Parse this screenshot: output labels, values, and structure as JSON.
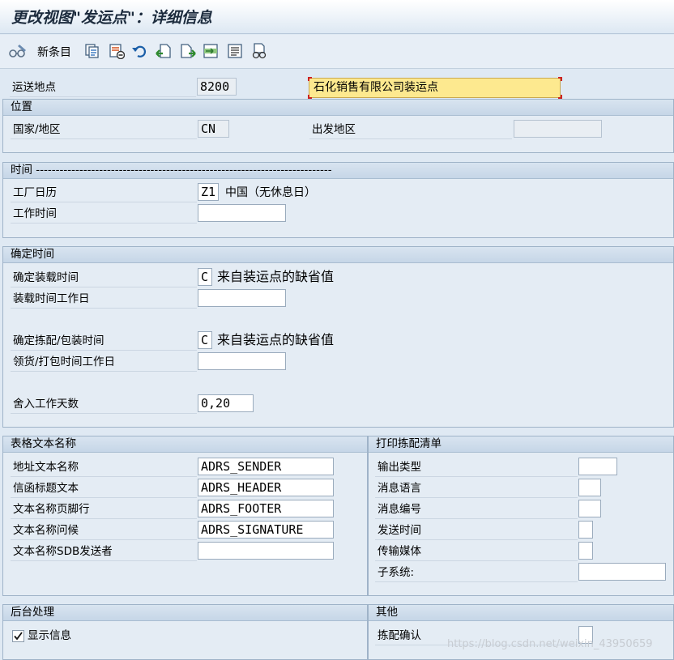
{
  "title": "更改视图\"发运点\"：详细信息",
  "toolbar": {
    "new_entries": "新条目",
    "icons": [
      "glasses-edit-icon",
      "copy-icon",
      "delete-icon",
      "undo-icon",
      "previous-entry-icon",
      "next-entry-icon",
      "select-block-icon",
      "select-all-icon",
      "print-icon"
    ]
  },
  "header": {
    "shipping_point_label": "运送地点",
    "shipping_point_value": "8200",
    "shipping_point_desc": "石化销售有限公司装运点"
  },
  "location": {
    "title": "位置",
    "country_label": "国家/地区",
    "country_value": "CN",
    "departure_zone_label": "出发地区",
    "departure_zone_value": ""
  },
  "time": {
    "title": "时间 ---------------------------------------------------------------------------",
    "factory_calendar_label": "工厂日历",
    "factory_calendar_value": "Z1",
    "factory_calendar_desc": "中国（无休息日）",
    "working_times_label": "工作时间",
    "working_times_value": ""
  },
  "determine_times": {
    "title": "确定时间",
    "loading_time_label": "确定装载时间",
    "loading_time_value": "C",
    "loading_time_desc": "来自装运点的缺省值",
    "loading_workday_label": "装载时间工作日",
    "loading_workday_value": "",
    "pick_pack_label": "确定拣配/包装时间",
    "pick_pack_value": "C",
    "pick_pack_desc": "来自装运点的缺省值",
    "pick_pack_workday_label": "领货/打包时间工作日",
    "pick_pack_workday_value": "",
    "rounding_label": "舍入工作天数",
    "rounding_value": "0,20"
  },
  "form_text": {
    "title": "表格文本名称",
    "rows": [
      {
        "label": "地址文本名称",
        "value": "ADRS_SENDER"
      },
      {
        "label": "信函标题文本",
        "value": "ADRS_HEADER"
      },
      {
        "label": "文本名称页脚行",
        "value": "ADRS_FOOTER"
      },
      {
        "label": "文本名称问候",
        "value": "ADRS_SIGNATURE"
      },
      {
        "label": "文本名称SDB发送者",
        "value": ""
      }
    ]
  },
  "picking_list": {
    "title": "打印拣配清单",
    "rows": [
      {
        "label": "输出类型",
        "value": ""
      },
      {
        "label": "消息语言",
        "value": ""
      },
      {
        "label": "消息编号",
        "value": ""
      },
      {
        "label": "发送时间",
        "value": ""
      },
      {
        "label": "传输媒体",
        "value": ""
      },
      {
        "label": "子系统:",
        "value": ""
      }
    ]
  },
  "background": {
    "title": "后台处理",
    "show_info_label": "显示信息",
    "show_info_checked": true
  },
  "other": {
    "title": "其他",
    "pick_confirm_label": "拣配确认",
    "pick_confirm_checked": false
  },
  "watermark": "https://blog.csdn.net/weixin_43950659"
}
